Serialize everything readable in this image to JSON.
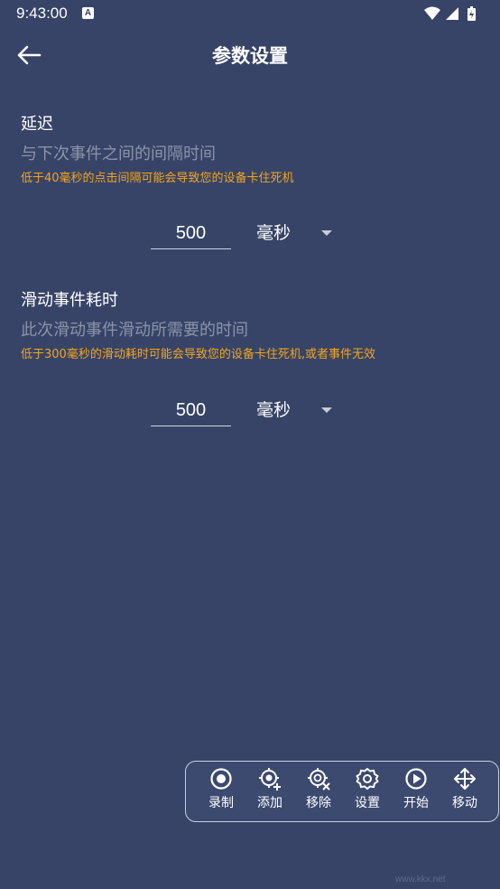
{
  "status": {
    "time": "9:43:00",
    "notif_badge": "A"
  },
  "toolbar": {
    "title": "参数设置"
  },
  "delay": {
    "title": "延迟",
    "desc": "与下次事件之间的间隔时间",
    "warn": "低于40毫秒的点击间隔可能会导致您的设备卡住死机",
    "value": "500",
    "unit": "毫秒"
  },
  "swipe": {
    "title": "滑动事件耗时",
    "desc": "此次滑动事件滑动所需要的时间",
    "warn": "低于300毫秒的滑动耗时可能会导致您的设备卡住死机,或者事件无效",
    "value": "500",
    "unit": "毫秒"
  },
  "panel": {
    "items": [
      {
        "label": "录制",
        "icon": "record-icon"
      },
      {
        "label": "添加",
        "icon": "add-target-icon"
      },
      {
        "label": "移除",
        "icon": "remove-target-icon"
      },
      {
        "label": "设置",
        "icon": "gear-icon"
      },
      {
        "label": "开始",
        "icon": "play-icon"
      },
      {
        "label": "移动",
        "icon": "move-icon"
      }
    ]
  },
  "watermark": "www.kkx.net",
  "colors": {
    "background": "#374467",
    "warning": "#f4a51c",
    "muted_text": "#8b93a8"
  }
}
